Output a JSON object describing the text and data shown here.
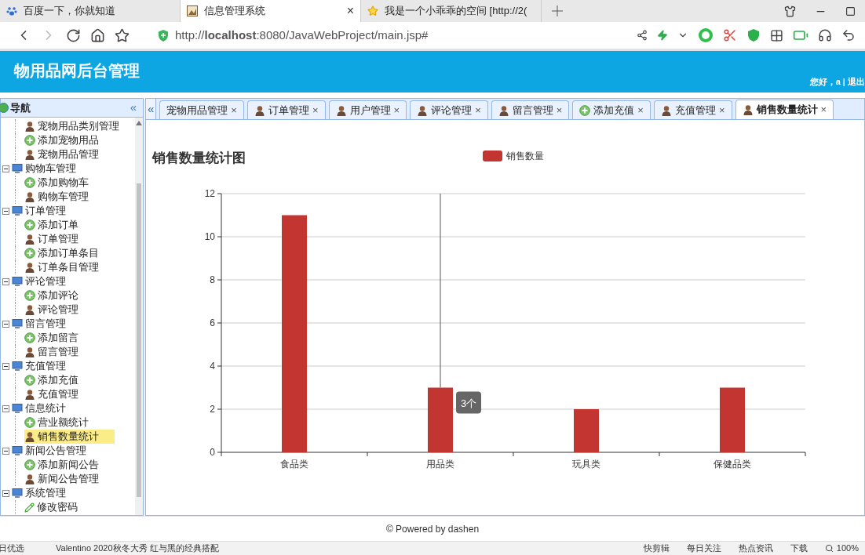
{
  "browser": {
    "tabs": [
      {
        "title": "百度一下，你就知道",
        "kind": "paw",
        "selected": false
      },
      {
        "title": "信息管理系统",
        "kind": "image",
        "selected": true,
        "close": "×"
      },
      {
        "title": "我是一个小乖乖的空间 [http://2(",
        "kind": "star",
        "selected": false
      }
    ],
    "address": "http://**localhost**:8080/JavaWebProject/main.jsp#"
  },
  "header": {
    "title": "物用品网后台管理",
    "greeting": "您好，a | 退出"
  },
  "nav": {
    "title": "导航",
    "collapse": "«",
    "tree": [
      {
        "children": [
          {
            "label": "宠物用品类别管理",
            "kind": "user",
            "selected": false
          },
          {
            "label": "添加宠物用品",
            "kind": "add",
            "selected": false
          },
          {
            "label": "宠物用品管理",
            "kind": "user",
            "selected": false
          }
        ]
      },
      {
        "label": "购物车管理",
        "expanded": true,
        "children": [
          {
            "label": "添加购物车",
            "kind": "add",
            "selected": false
          },
          {
            "label": "购物车管理",
            "kind": "user",
            "selected": false
          }
        ]
      },
      {
        "label": "订单管理",
        "expanded": true,
        "children": [
          {
            "label": "添加订单",
            "kind": "add",
            "selected": false
          },
          {
            "label": "订单管理",
            "kind": "user",
            "selected": false
          },
          {
            "label": "添加订单条目",
            "kind": "add",
            "selected": false
          },
          {
            "label": "订单条目管理",
            "kind": "user",
            "selected": false
          }
        ]
      },
      {
        "label": "评论管理",
        "expanded": true,
        "children": [
          {
            "label": "添加评论",
            "kind": "add",
            "selected": false
          },
          {
            "label": "评论管理",
            "kind": "user",
            "selected": false
          }
        ]
      },
      {
        "label": "留言管理",
        "expanded": true,
        "children": [
          {
            "label": "添加留言",
            "kind": "add",
            "selected": false
          },
          {
            "label": "留言管理",
            "kind": "user",
            "selected": false
          }
        ]
      },
      {
        "label": "充值管理",
        "expanded": true,
        "children": [
          {
            "label": "添加充值",
            "kind": "add",
            "selected": false
          },
          {
            "label": "充值管理",
            "kind": "user",
            "selected": false
          }
        ]
      },
      {
        "label": "信息统计",
        "expanded": true,
        "children": [
          {
            "label": "营业额统计",
            "kind": "add",
            "selected": false
          },
          {
            "label": "销售数量统计",
            "kind": "user",
            "selected": true
          }
        ]
      },
      {
        "label": "新闻公告管理",
        "expanded": true,
        "children": [
          {
            "label": "添加新闻公告",
            "kind": "add",
            "selected": false
          },
          {
            "label": "新闻公告管理",
            "kind": "user",
            "selected": false
          }
        ]
      },
      {
        "label": "系统管理",
        "expanded": true,
        "children": [
          {
            "label": "修改密码",
            "kind": "pencil",
            "selected": false
          }
        ]
      }
    ]
  },
  "tabs_scroll": "«",
  "tabs": [
    {
      "label": "宠物用品管理",
      "kind": "plain",
      "selected": false,
      "close": "×"
    },
    {
      "label": "订单管理",
      "kind": "user",
      "selected": false,
      "close": "×"
    },
    {
      "label": "用户管理",
      "kind": "user",
      "selected": false,
      "close": "×"
    },
    {
      "label": "评论管理",
      "kind": "user",
      "selected": false,
      "close": "×"
    },
    {
      "label": "留言管理",
      "kind": "user",
      "selected": false,
      "close": "×"
    },
    {
      "label": "添加充值",
      "kind": "add",
      "selected": false,
      "close": "×"
    },
    {
      "label": "充值管理",
      "kind": "user",
      "selected": false,
      "close": "×"
    },
    {
      "label": "销售数量统计",
      "kind": "user",
      "selected": true,
      "close": "×"
    }
  ],
  "chart_data": {
    "type": "bar",
    "title": "销售数量统计图",
    "categories": [
      "食品类",
      "用品类",
      "玩具类",
      "保健品类"
    ],
    "series": [
      {
        "name": "销售数量",
        "color": "#c23531",
        "values": [
          11,
          3,
          2,
          3
        ]
      }
    ],
    "ylim": [
      0,
      12
    ],
    "yticks": [
      0,
      2,
      4,
      6,
      8,
      10,
      12
    ],
    "grid": true,
    "ref_lines": [
      {
        "axis": "x",
        "value": "用品类"
      }
    ],
    "annotations": [
      {
        "x": "用品类",
        "y": 3,
        "text": "3个"
      }
    ]
  },
  "footer": "© Powered by dashen",
  "status_bar": {
    "left": [
      "日优选",
      "Valentino 2020秋冬大秀 红与黑的经典搭配"
    ],
    "right": [
      "快剪辑",
      "每日关注",
      "热点资讯",
      "下载"
    ],
    "zoom": "100%"
  }
}
